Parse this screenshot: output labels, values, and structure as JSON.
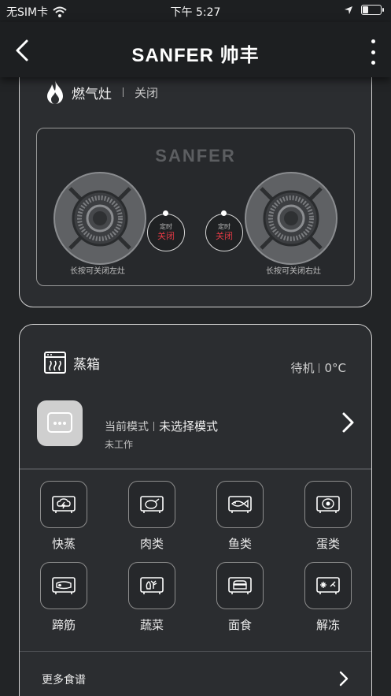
{
  "status_bar": {
    "carrier": "无SIM卡",
    "time": "下午 5:27"
  },
  "nav": {
    "brand": "SANFER 帅丰"
  },
  "stove": {
    "title": "燃气灶",
    "state": "关闭",
    "panel_logo": "SANFER",
    "left_timer": {
      "label": "定时",
      "state": "关闭"
    },
    "right_timer": {
      "label": "定时",
      "state": "关闭"
    },
    "left_hint": "长按可关闭左灶",
    "right_hint": "长按可关闭右灶"
  },
  "steamer": {
    "title": "蒸箱",
    "status": "待机",
    "temperature": "0°C",
    "mode_label": "当前模式",
    "mode_value": "未选择模式",
    "work_state": "未工作",
    "recipes": [
      {
        "label": "快蒸",
        "icon": "quick-steam-icon"
      },
      {
        "label": "肉类",
        "icon": "meat-icon"
      },
      {
        "label": "鱼类",
        "icon": "fish-icon"
      },
      {
        "label": "蛋类",
        "icon": "egg-icon"
      },
      {
        "label": "蹄筋",
        "icon": "tendon-icon"
      },
      {
        "label": "蔬菜",
        "icon": "vegetable-icon"
      },
      {
        "label": "面食",
        "icon": "pastry-icon"
      },
      {
        "label": "解冻",
        "icon": "defrost-icon"
      }
    ],
    "more_recipes": "更多食谱"
  },
  "colors": {
    "background": "#222426",
    "card": "#2b2d30",
    "timer_off": "#e43a45"
  }
}
